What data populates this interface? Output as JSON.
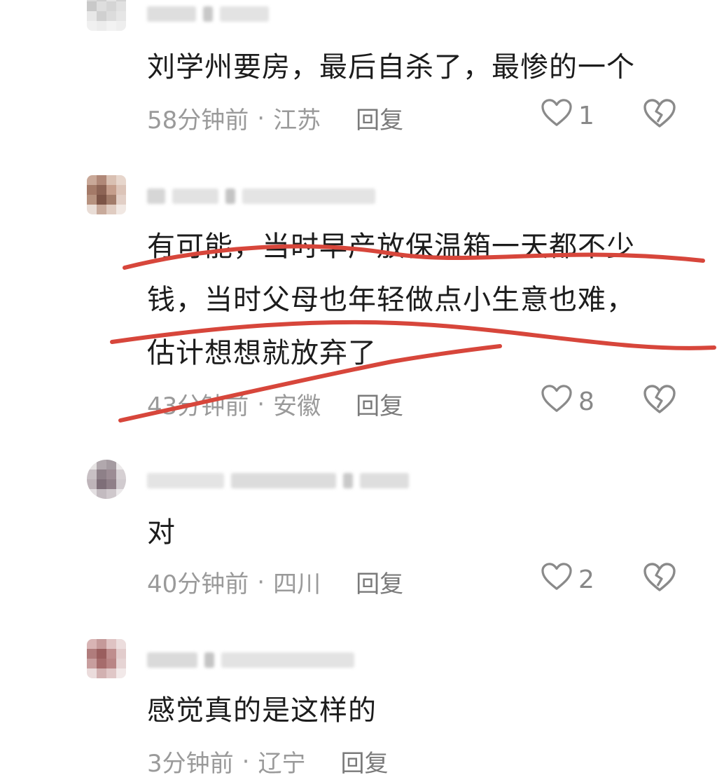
{
  "comments": [
    {
      "text_lines": [
        "刘学州要房，最后自杀了，最惨的一个"
      ],
      "time": "58分钟前",
      "location": "江苏",
      "reply_label": "回复",
      "likes": "1"
    },
    {
      "text_lines": [
        "有可能，当时早产放保温箱一天都不少",
        "钱，当时父母也年轻做点小生意也难，",
        "估计想想就放弃了"
      ],
      "time": "43分钟前",
      "location": "安徽",
      "reply_label": "回复",
      "likes": "8"
    },
    {
      "text_lines": [
        "对"
      ],
      "time": "40分钟前",
      "location": "四川",
      "reply_label": "回复",
      "likes": "2"
    },
    {
      "text_lines": [
        "感觉真的是这样的"
      ],
      "time": "3分钟前",
      "location": "辽宁",
      "reply_label": "回复"
    }
  ],
  "separator": "·",
  "icons": {
    "like": "heart-outline-icon",
    "dislike": "broken-heart-icon"
  },
  "colors": {
    "annotation_red": "#d7463b",
    "meta_gray": "#9a9a9a"
  }
}
